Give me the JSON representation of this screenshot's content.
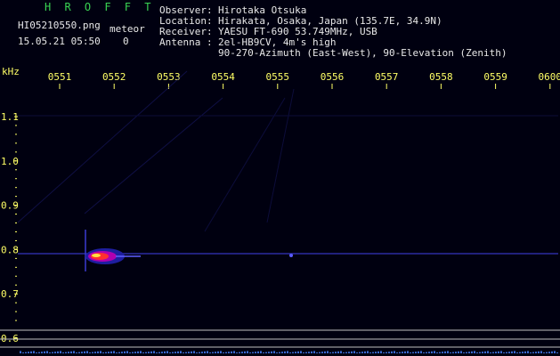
{
  "header": {
    "brand": "H R O F F T",
    "filename": "HI05210550.png",
    "datetime": "15.05.21 05:50",
    "count_label": "meteor",
    "count_value": "0"
  },
  "info": {
    "observer_label": "Observer",
    "observer": "Hirotaka Otsuka",
    "location_label": "Location",
    "location": "Hirakata, Osaka, Japan (135.7E, 34.9N)",
    "receiver_label": "Receiver",
    "receiver": "YAESU FT-690 53.749MHz, USB",
    "antenna_label": "Antenna",
    "antenna": "2el-HB9CV, 4m's high",
    "antenna_detail": "90-270-Azimuth (East-West), 90-Elevation (Zenith)"
  },
  "axis": {
    "y_unit": "kHz",
    "x_ticks": [
      "0551",
      "0552",
      "0553",
      "0554",
      "0555",
      "0556",
      "0557",
      "0558",
      "0559",
      "0600"
    ],
    "y_ticks": [
      "1.1",
      "1.0",
      "0.9",
      "0.8",
      "0.7",
      "0.6"
    ]
  },
  "colors": {
    "background": "#000010",
    "brand": "#39d353",
    "text": "#e8e8e8",
    "axis": "#ffff66",
    "trace": "#2a2aa0"
  }
}
